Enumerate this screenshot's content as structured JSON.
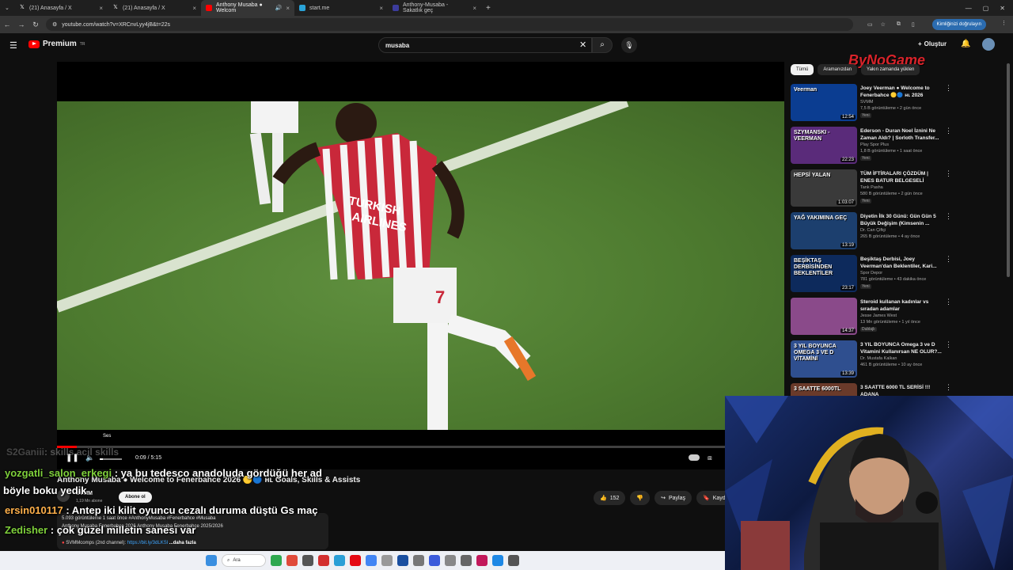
{
  "browser": {
    "tabs": [
      {
        "label": "(21) Anasayfa / X",
        "icon": "x-logo-icon"
      },
      {
        "label": "(21) Anasayfa / X",
        "icon": "x-logo-icon"
      },
      {
        "label": "Anthony Musaba ● Welcom",
        "icon": "youtube-icon",
        "active": true
      },
      {
        "label": "start.me",
        "icon": "startme-icon"
      },
      {
        "label": "Anthony-Musaba - Sakatlık geç",
        "icon": "news-icon"
      }
    ],
    "url": "youtube.com/watch?v=XRCnvLyy4jB&t=22s",
    "profile_label": "Kimliğinizi doğrulayın"
  },
  "youtube": {
    "logo_text": "Premium",
    "logo_sup": "TR",
    "search_value": "musaba",
    "create_label": "Oluştur",
    "chips": [
      "Tümü",
      "Aramanızdan",
      "Yakın zamanda yüklen"
    ],
    "video": {
      "time": "0:09 / 5:15",
      "volume_tooltip": "Ses",
      "progress_fraction": 0.029,
      "title": "Anthony Musaba ● Welcome to Fenerbahce 2026 🟡🔵 ʜʟ Goals, Skills & Assists",
      "channel": "SVMM",
      "subscribers": "1,19 Mn abone",
      "subscribe_label": "Abone ol",
      "views_line": "5.093 görüntüleme  1 saat önce  #AnthonyMusaba #Fenerbahce #Musaba",
      "desc_line": "Anthony Musaba Fenerbahçe 2026 Anthony Musaba Fenerbahçe 2025/2026",
      "link_line_prefix": "SVMMcomps (2nd channel): ",
      "link_line_url": "https://bit.ly/3dLKSl",
      "more_label": "...daha fazla",
      "likes": "152",
      "share_label": "Paylaş",
      "save_label": "Kaydet"
    },
    "recommendations": [
      {
        "title": "Joey Veerman ● Welcome to Fenerbahce 🟡🔵 ʜʟ 2026",
        "channel": "SVMM",
        "meta": "7,5 B görüntüleme • 2 gün önce",
        "badge": "Yeni",
        "duration": "12:54",
        "thumb_text": "Veerman"
      },
      {
        "title": "Ederson - Duran Noel İznini Ne Zaman Aldı? | Sorloth Transfer...",
        "channel": "Play Spor Plus",
        "meta": "1,8 B görüntüleme • 1 saat önce",
        "badge": "Yeni",
        "duration": "22:23",
        "thumb_text": "SZYMANSKI - VEERMAN"
      },
      {
        "title": "TÜM İFTİRALARI ÇÖZDÜM | ENES BATUR BELGESELİ",
        "channel": "Tank Pasha",
        "meta": "580 B görüntüleme • 2 gün önce",
        "badge": "Yeni",
        "duration": "1:03:07",
        "thumb_text": "HEPSİ YALAN"
      },
      {
        "title": "Diyetin İlk 30 Günü: Gün Gün 5 Büyük Değişim (Kimsenin ...",
        "channel": "Dr. Can Çiftçi",
        "meta": "265 B görüntüleme • 4 ay önce",
        "badge": "",
        "duration": "13:19",
        "thumb_text": "YAĞ YAKIMINA GEÇ"
      },
      {
        "title": "Beşiktaş Derbisi, Joey Veerman'dan Beklentiler, Kari...",
        "channel": "Spor Depor",
        "meta": "781 görüntüleme • 43 dakika önce",
        "badge": "Yeni",
        "duration": "23:17",
        "thumb_text": "BEŞİKTAŞ DERBİSİNDEN BEKLENTİLER"
      },
      {
        "title": "Steroid kullanan kadınlar vs sıradan adamlar",
        "channel": "Jesse James West",
        "meta": "13 Mn görüntüleme • 1 yıl önce",
        "badge": "Dublajlı",
        "duration": "14:37",
        "thumb_text": ""
      },
      {
        "title": "3 YIL BOYUNCA Omega 3 ve D Vitamini Kullanırsan NE OLUR?...",
        "channel": "Dr. Mustafa Kalkan",
        "meta": "461 B görüntüleme • 10 ay önce",
        "badge": "",
        "duration": "13:39",
        "thumb_text": "3 YIL BOYUNCA OMEGA 3 VE D VİTAMİNİ"
      },
      {
        "title": "3 SAATTE 6000 TL SERİSİ !!! ADANA",
        "channel": "",
        "meta": "",
        "badge": "",
        "duration": "",
        "thumb_text": "3 SAATTE 6000TL"
      }
    ]
  },
  "stream_overlay": {
    "faded_line": {
      "user": "S2Ganiii",
      "text": ": skills acil skills"
    },
    "chat": [
      {
        "user": "yozgatli_salon_erkegi",
        "text": " : ya bu tedesco anadoluda gördüğü her ad",
        "cont": "böyle boku yedik",
        "color": "#7fd13b"
      },
      {
        "user": "ersin010117",
        "text": " : Antep iki kilit oyuncu cezalı duruma düştü Gs maç",
        "cont": "",
        "color": "#ffb04a"
      },
      {
        "user": "Zedisher",
        "text": " : çok güzel milletin sanesi var",
        "cont": "",
        "color": "#7fd13b"
      }
    ],
    "watermark": "ByNoGame"
  },
  "taskbar": {
    "search_label": "Ara"
  },
  "colors": {
    "accent": "#ff0000",
    "chat_green": "#7fd13b",
    "chat_orange": "#ffb04a"
  }
}
